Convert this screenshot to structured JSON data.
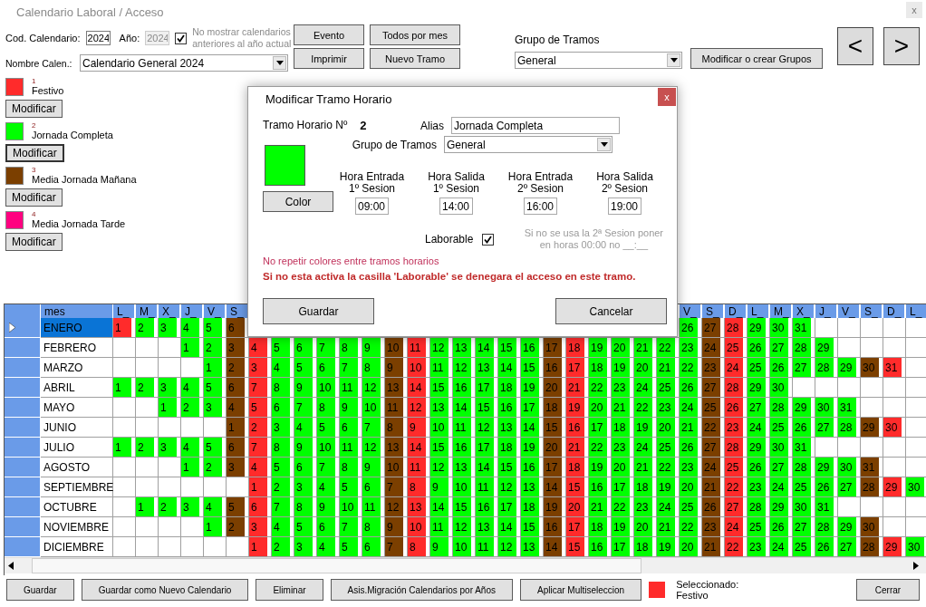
{
  "window": {
    "title": "Calendario Laboral / Acceso",
    "close": "x"
  },
  "form": {
    "cod_label": "Cod. Calendario:",
    "cod_value": "2024",
    "year_label": "Año:",
    "year_value": "2024",
    "year_disabled": true,
    "hide_old": {
      "label": "No mostrar calendarios anteriores al año actual",
      "checked": true
    },
    "name_label": "Nombre Calen.:",
    "name_value": "Calendario General 2024"
  },
  "toolbar": [
    "Evento",
    "Todos por mes",
    "Imprimir",
    "Nuevo Tramo"
  ],
  "group": {
    "label": "Grupo de Tramos",
    "value": "General",
    "button": "Modificar o crear Grupos"
  },
  "nav": [
    "<",
    ">"
  ],
  "tramos": [
    {
      "number": "1",
      "name": "Festivo",
      "color": "#ff2b2b",
      "button": "Modificar",
      "focused": false
    },
    {
      "number": "2",
      "name": "Jornada Completa",
      "color": "#00ff00",
      "button": "Modificar",
      "focused": true
    },
    {
      "number": "3",
      "name": "Media Jornada Mañana",
      "color": "#7b3f00",
      "button": "Modificar",
      "focused": false
    },
    {
      "number": "4",
      "name": "Media Jornada Tarde",
      "color": "#ff0080",
      "button": "Modificar",
      "focused": false
    }
  ],
  "grid": {
    "header": "mes",
    "columns": [
      "L_",
      "M_",
      "X_",
      "J_",
      "V_",
      "S_",
      null,
      null,
      null,
      null,
      null,
      null,
      null,
      null,
      null,
      null,
      null,
      null,
      null,
      null,
      null,
      null,
      null,
      null,
      null,
      "V_",
      "S_",
      "D_",
      "L_",
      "M_",
      "X_",
      "J_",
      "V_",
      "S_",
      "D_",
      "L_"
    ],
    "months": [
      {
        "name": "ENERO",
        "selected": true,
        "cells": [
          {
            "day": "1",
            "color": "#ff2b2b"
          },
          {
            "day": "2",
            "color": "#00ff00"
          },
          {
            "day": "3",
            "color": "#00ff00"
          },
          {
            "day": "4",
            "color": "#00ff00"
          },
          {
            "day": "5",
            "color": "#00ff00"
          },
          {
            "day": "6",
            "color": "#7b3f00"
          },
          null,
          null,
          null,
          null,
          null,
          null,
          null,
          null,
          null,
          null,
          null,
          null,
          null,
          null,
          null,
          null,
          null,
          null,
          null,
          {
            "day": "26",
            "color": "#00ff00"
          },
          {
            "day": "27",
            "color": "#7b3f00"
          },
          {
            "day": "28",
            "color": "#ff2b2b"
          },
          {
            "day": "29",
            "color": "#00ff00"
          },
          {
            "day": "30",
            "color": "#00ff00"
          },
          {
            "day": "31",
            "color": "#00ff00"
          },
          null,
          null,
          null,
          null,
          null
        ]
      },
      {
        "name": "FEBRERO",
        "selected": false,
        "cells": [
          null,
          null,
          null,
          {
            "day": "1",
            "color": "#00ff00"
          },
          {
            "day": "2",
            "color": "#00ff00"
          },
          {
            "day": "3",
            "color": "#7b3f00"
          },
          {
            "day": "4",
            "color": "#ff2b2b"
          },
          {
            "day": "5",
            "color": "#00ff00"
          },
          {
            "day": "6",
            "color": "#00ff00"
          },
          {
            "day": "7",
            "color": "#00ff00"
          },
          {
            "day": "8",
            "color": "#00ff00"
          },
          {
            "day": "9",
            "color": "#00ff00"
          },
          {
            "day": "10",
            "color": "#7b3f00"
          },
          {
            "day": "11",
            "color": "#ff2b2b"
          },
          {
            "day": "12",
            "color": "#00ff00"
          },
          {
            "day": "13",
            "color": "#00ff00"
          },
          {
            "day": "14",
            "color": "#00ff00"
          },
          {
            "day": "15",
            "color": "#00ff00"
          },
          {
            "day": "16",
            "color": "#00ff00"
          },
          {
            "day": "17",
            "color": "#7b3f00"
          },
          {
            "day": "18",
            "color": "#ff2b2b"
          },
          {
            "day": "19",
            "color": "#00ff00"
          },
          {
            "day": "20",
            "color": "#00ff00"
          },
          {
            "day": "21",
            "color": "#00ff00"
          },
          {
            "day": "22",
            "color": "#00ff00"
          },
          {
            "day": "23",
            "color": "#00ff00"
          },
          {
            "day": "24",
            "color": "#7b3f00"
          },
          {
            "day": "25",
            "color": "#ff2b2b"
          },
          {
            "day": "26",
            "color": "#00ff00"
          },
          {
            "day": "27",
            "color": "#00ff00"
          },
          {
            "day": "28",
            "color": "#00ff00"
          },
          {
            "day": "29",
            "color": "#00ff00"
          },
          null,
          null,
          null,
          null
        ]
      },
      {
        "name": "MARZO",
        "selected": false,
        "cells": [
          null,
          null,
          null,
          null,
          {
            "day": "1",
            "color": "#00ff00"
          },
          {
            "day": "2",
            "color": "#7b3f00"
          },
          {
            "day": "3",
            "color": "#ff2b2b"
          },
          {
            "day": "4",
            "color": "#00ff00"
          },
          {
            "day": "5",
            "color": "#00ff00"
          },
          {
            "day": "6",
            "color": "#00ff00"
          },
          {
            "day": "7",
            "color": "#00ff00"
          },
          {
            "day": "8",
            "color": "#00ff00"
          },
          {
            "day": "9",
            "color": "#7b3f00"
          },
          {
            "day": "10",
            "color": "#ff2b2b"
          },
          {
            "day": "11",
            "color": "#00ff00"
          },
          {
            "day": "12",
            "color": "#00ff00"
          },
          {
            "day": "13",
            "color": "#00ff00"
          },
          {
            "day": "14",
            "color": "#00ff00"
          },
          {
            "day": "15",
            "color": "#00ff00"
          },
          {
            "day": "16",
            "color": "#7b3f00"
          },
          {
            "day": "17",
            "color": "#ff2b2b"
          },
          {
            "day": "18",
            "color": "#00ff00"
          },
          {
            "day": "19",
            "color": "#00ff00"
          },
          {
            "day": "20",
            "color": "#00ff00"
          },
          {
            "day": "21",
            "color": "#00ff00"
          },
          {
            "day": "22",
            "color": "#00ff00"
          },
          {
            "day": "23",
            "color": "#7b3f00"
          },
          {
            "day": "24",
            "color": "#ff2b2b"
          },
          {
            "day": "25",
            "color": "#00ff00"
          },
          {
            "day": "26",
            "color": "#00ff00"
          },
          {
            "day": "27",
            "color": "#00ff00"
          },
          {
            "day": "28",
            "color": "#00ff00"
          },
          {
            "day": "29",
            "color": "#00ff00"
          },
          {
            "day": "30",
            "color": "#7b3f00"
          },
          {
            "day": "31",
            "color": "#ff2b2b"
          },
          null
        ]
      },
      {
        "name": "ABRIL",
        "selected": false,
        "cells": [
          {
            "day": "1",
            "color": "#00ff00"
          },
          {
            "day": "2",
            "color": "#00ff00"
          },
          {
            "day": "3",
            "color": "#00ff00"
          },
          {
            "day": "4",
            "color": "#00ff00"
          },
          {
            "day": "5",
            "color": "#00ff00"
          },
          {
            "day": "6",
            "color": "#7b3f00"
          },
          {
            "day": "7",
            "color": "#ff2b2b"
          },
          {
            "day": "8",
            "color": "#00ff00"
          },
          {
            "day": "9",
            "color": "#00ff00"
          },
          {
            "day": "10",
            "color": "#00ff00"
          },
          {
            "day": "11",
            "color": "#00ff00"
          },
          {
            "day": "12",
            "color": "#00ff00"
          },
          {
            "day": "13",
            "color": "#7b3f00"
          },
          {
            "day": "14",
            "color": "#ff2b2b"
          },
          {
            "day": "15",
            "color": "#00ff00"
          },
          {
            "day": "16",
            "color": "#00ff00"
          },
          {
            "day": "17",
            "color": "#00ff00"
          },
          {
            "day": "18",
            "color": "#00ff00"
          },
          {
            "day": "19",
            "color": "#00ff00"
          },
          {
            "day": "20",
            "color": "#7b3f00"
          },
          {
            "day": "21",
            "color": "#ff2b2b"
          },
          {
            "day": "22",
            "color": "#00ff00"
          },
          {
            "day": "23",
            "color": "#00ff00"
          },
          {
            "day": "24",
            "color": "#00ff00"
          },
          {
            "day": "25",
            "color": "#00ff00"
          },
          {
            "day": "26",
            "color": "#00ff00"
          },
          {
            "day": "27",
            "color": "#7b3f00"
          },
          {
            "day": "28",
            "color": "#ff2b2b"
          },
          {
            "day": "29",
            "color": "#00ff00"
          },
          {
            "day": "30",
            "color": "#00ff00"
          },
          null,
          null,
          null,
          null,
          null,
          null
        ]
      },
      {
        "name": "MAYO",
        "selected": false,
        "cells": [
          null,
          null,
          {
            "day": "1",
            "color": "#00ff00"
          },
          {
            "day": "2",
            "color": "#00ff00"
          },
          {
            "day": "3",
            "color": "#00ff00"
          },
          {
            "day": "4",
            "color": "#7b3f00"
          },
          {
            "day": "5",
            "color": "#ff2b2b"
          },
          {
            "day": "6",
            "color": "#00ff00"
          },
          {
            "day": "7",
            "color": "#00ff00"
          },
          {
            "day": "8",
            "color": "#00ff00"
          },
          {
            "day": "9",
            "color": "#00ff00"
          },
          {
            "day": "10",
            "color": "#00ff00"
          },
          {
            "day": "11",
            "color": "#7b3f00"
          },
          {
            "day": "12",
            "color": "#ff2b2b"
          },
          {
            "day": "13",
            "color": "#00ff00"
          },
          {
            "day": "14",
            "color": "#00ff00"
          },
          {
            "day": "15",
            "color": "#00ff00"
          },
          {
            "day": "16",
            "color": "#00ff00"
          },
          {
            "day": "17",
            "color": "#00ff00"
          },
          {
            "day": "18",
            "color": "#7b3f00"
          },
          {
            "day": "19",
            "color": "#ff2b2b"
          },
          {
            "day": "20",
            "color": "#00ff00"
          },
          {
            "day": "21",
            "color": "#00ff00"
          },
          {
            "day": "22",
            "color": "#00ff00"
          },
          {
            "day": "23",
            "color": "#00ff00"
          },
          {
            "day": "24",
            "color": "#00ff00"
          },
          {
            "day": "25",
            "color": "#7b3f00"
          },
          {
            "day": "26",
            "color": "#ff2b2b"
          },
          {
            "day": "27",
            "color": "#00ff00"
          },
          {
            "day": "28",
            "color": "#00ff00"
          },
          {
            "day": "29",
            "color": "#00ff00"
          },
          {
            "day": "30",
            "color": "#00ff00"
          },
          {
            "day": "31",
            "color": "#00ff00"
          },
          null,
          null,
          null
        ]
      },
      {
        "name": "JUNIO",
        "selected": false,
        "cells": [
          null,
          null,
          null,
          null,
          null,
          {
            "day": "1",
            "color": "#7b3f00"
          },
          {
            "day": "2",
            "color": "#ff2b2b"
          },
          {
            "day": "3",
            "color": "#00ff00"
          },
          {
            "day": "4",
            "color": "#00ff00"
          },
          {
            "day": "5",
            "color": "#00ff00"
          },
          {
            "day": "6",
            "color": "#00ff00"
          },
          {
            "day": "7",
            "color": "#00ff00"
          },
          {
            "day": "8",
            "color": "#7b3f00"
          },
          {
            "day": "9",
            "color": "#ff2b2b"
          },
          {
            "day": "10",
            "color": "#00ff00"
          },
          {
            "day": "11",
            "color": "#00ff00"
          },
          {
            "day": "12",
            "color": "#00ff00"
          },
          {
            "day": "13",
            "color": "#00ff00"
          },
          {
            "day": "14",
            "color": "#00ff00"
          },
          {
            "day": "15",
            "color": "#7b3f00"
          },
          {
            "day": "16",
            "color": "#ff2b2b"
          },
          {
            "day": "17",
            "color": "#00ff00"
          },
          {
            "day": "18",
            "color": "#00ff00"
          },
          {
            "day": "19",
            "color": "#00ff00"
          },
          {
            "day": "20",
            "color": "#00ff00"
          },
          {
            "day": "21",
            "color": "#00ff00"
          },
          {
            "day": "22",
            "color": "#7b3f00"
          },
          {
            "day": "23",
            "color": "#ff2b2b"
          },
          {
            "day": "24",
            "color": "#00ff00"
          },
          {
            "day": "25",
            "color": "#00ff00"
          },
          {
            "day": "26",
            "color": "#00ff00"
          },
          {
            "day": "27",
            "color": "#00ff00"
          },
          {
            "day": "28",
            "color": "#00ff00"
          },
          {
            "day": "29",
            "color": "#7b3f00"
          },
          {
            "day": "30",
            "color": "#ff2b2b"
          },
          null
        ]
      },
      {
        "name": "JULIO",
        "selected": false,
        "cells": [
          {
            "day": "1",
            "color": "#00ff00"
          },
          {
            "day": "2",
            "color": "#00ff00"
          },
          {
            "day": "3",
            "color": "#00ff00"
          },
          {
            "day": "4",
            "color": "#00ff00"
          },
          {
            "day": "5",
            "color": "#00ff00"
          },
          {
            "day": "6",
            "color": "#7b3f00"
          },
          {
            "day": "7",
            "color": "#ff2b2b"
          },
          {
            "day": "8",
            "color": "#00ff00"
          },
          {
            "day": "9",
            "color": "#00ff00"
          },
          {
            "day": "10",
            "color": "#00ff00"
          },
          {
            "day": "11",
            "color": "#00ff00"
          },
          {
            "day": "12",
            "color": "#00ff00"
          },
          {
            "day": "13",
            "color": "#7b3f00"
          },
          {
            "day": "14",
            "color": "#ff2b2b"
          },
          {
            "day": "15",
            "color": "#00ff00"
          },
          {
            "day": "16",
            "color": "#00ff00"
          },
          {
            "day": "17",
            "color": "#00ff00"
          },
          {
            "day": "18",
            "color": "#00ff00"
          },
          {
            "day": "19",
            "color": "#00ff00"
          },
          {
            "day": "20",
            "color": "#7b3f00"
          },
          {
            "day": "21",
            "color": "#ff2b2b"
          },
          {
            "day": "22",
            "color": "#00ff00"
          },
          {
            "day": "23",
            "color": "#00ff00"
          },
          {
            "day": "24",
            "color": "#00ff00"
          },
          {
            "day": "25",
            "color": "#00ff00"
          },
          {
            "day": "26",
            "color": "#00ff00"
          },
          {
            "day": "27",
            "color": "#7b3f00"
          },
          {
            "day": "28",
            "color": "#ff2b2b"
          },
          {
            "day": "29",
            "color": "#00ff00"
          },
          {
            "day": "30",
            "color": "#00ff00"
          },
          {
            "day": "31",
            "color": "#00ff00"
          },
          null,
          null,
          null,
          null,
          null
        ]
      },
      {
        "name": "AGOSTO",
        "selected": false,
        "cells": [
          null,
          null,
          null,
          {
            "day": "1",
            "color": "#00ff00"
          },
          {
            "day": "2",
            "color": "#00ff00"
          },
          {
            "day": "3",
            "color": "#7b3f00"
          },
          {
            "day": "4",
            "color": "#ff2b2b"
          },
          {
            "day": "5",
            "color": "#00ff00"
          },
          {
            "day": "6",
            "color": "#00ff00"
          },
          {
            "day": "7",
            "color": "#00ff00"
          },
          {
            "day": "8",
            "color": "#00ff00"
          },
          {
            "day": "9",
            "color": "#00ff00"
          },
          {
            "day": "10",
            "color": "#7b3f00"
          },
          {
            "day": "11",
            "color": "#ff2b2b"
          },
          {
            "day": "12",
            "color": "#00ff00"
          },
          {
            "day": "13",
            "color": "#00ff00"
          },
          {
            "day": "14",
            "color": "#00ff00"
          },
          {
            "day": "15",
            "color": "#00ff00"
          },
          {
            "day": "16",
            "color": "#00ff00"
          },
          {
            "day": "17",
            "color": "#7b3f00"
          },
          {
            "day": "18",
            "color": "#ff2b2b"
          },
          {
            "day": "19",
            "color": "#00ff00"
          },
          {
            "day": "20",
            "color": "#00ff00"
          },
          {
            "day": "21",
            "color": "#00ff00"
          },
          {
            "day": "22",
            "color": "#00ff00"
          },
          {
            "day": "23",
            "color": "#00ff00"
          },
          {
            "day": "24",
            "color": "#7b3f00"
          },
          {
            "day": "25",
            "color": "#ff2b2b"
          },
          {
            "day": "26",
            "color": "#00ff00"
          },
          {
            "day": "27",
            "color": "#00ff00"
          },
          {
            "day": "28",
            "color": "#00ff00"
          },
          {
            "day": "29",
            "color": "#00ff00"
          },
          {
            "day": "30",
            "color": "#00ff00"
          },
          {
            "day": "31",
            "color": "#7b3f00"
          },
          null,
          null
        ]
      },
      {
        "name": "SEPTIEMBRE",
        "selected": false,
        "cells": [
          null,
          null,
          null,
          null,
          null,
          null,
          {
            "day": "1",
            "color": "#ff2b2b"
          },
          {
            "day": "2",
            "color": "#00ff00"
          },
          {
            "day": "3",
            "color": "#00ff00"
          },
          {
            "day": "4",
            "color": "#00ff00"
          },
          {
            "day": "5",
            "color": "#00ff00"
          },
          {
            "day": "6",
            "color": "#00ff00"
          },
          {
            "day": "7",
            "color": "#7b3f00"
          },
          {
            "day": "8",
            "color": "#ff2b2b"
          },
          {
            "day": "9",
            "color": "#00ff00"
          },
          {
            "day": "10",
            "color": "#00ff00"
          },
          {
            "day": "11",
            "color": "#00ff00"
          },
          {
            "day": "12",
            "color": "#00ff00"
          },
          {
            "day": "13",
            "color": "#00ff00"
          },
          {
            "day": "14",
            "color": "#7b3f00"
          },
          {
            "day": "15",
            "color": "#ff2b2b"
          },
          {
            "day": "16",
            "color": "#00ff00"
          },
          {
            "day": "17",
            "color": "#00ff00"
          },
          {
            "day": "18",
            "color": "#00ff00"
          },
          {
            "day": "19",
            "color": "#00ff00"
          },
          {
            "day": "20",
            "color": "#00ff00"
          },
          {
            "day": "21",
            "color": "#7b3f00"
          },
          {
            "day": "22",
            "color": "#ff2b2b"
          },
          {
            "day": "23",
            "color": "#00ff00"
          },
          {
            "day": "24",
            "color": "#00ff00"
          },
          {
            "day": "25",
            "color": "#00ff00"
          },
          {
            "day": "26",
            "color": "#00ff00"
          },
          {
            "day": "27",
            "color": "#00ff00"
          },
          {
            "day": "28",
            "color": "#7b3f00"
          },
          {
            "day": "29",
            "color": "#ff2b2b"
          },
          {
            "day": "30",
            "color": "#00ff00"
          }
        ]
      },
      {
        "name": "OCTUBRE",
        "selected": false,
        "cells": [
          null,
          {
            "day": "1",
            "color": "#00ff00"
          },
          {
            "day": "2",
            "color": "#00ff00"
          },
          {
            "day": "3",
            "color": "#00ff00"
          },
          {
            "day": "4",
            "color": "#00ff00"
          },
          {
            "day": "5",
            "color": "#7b3f00"
          },
          {
            "day": "6",
            "color": "#ff2b2b"
          },
          {
            "day": "7",
            "color": "#00ff00"
          },
          {
            "day": "8",
            "color": "#00ff00"
          },
          {
            "day": "9",
            "color": "#00ff00"
          },
          {
            "day": "10",
            "color": "#00ff00"
          },
          {
            "day": "11",
            "color": "#00ff00"
          },
          {
            "day": "12",
            "color": "#7b3f00"
          },
          {
            "day": "13",
            "color": "#ff2b2b"
          },
          {
            "day": "14",
            "color": "#00ff00"
          },
          {
            "day": "15",
            "color": "#00ff00"
          },
          {
            "day": "16",
            "color": "#00ff00"
          },
          {
            "day": "17",
            "color": "#00ff00"
          },
          {
            "day": "18",
            "color": "#00ff00"
          },
          {
            "day": "19",
            "color": "#7b3f00"
          },
          {
            "day": "20",
            "color": "#ff2b2b"
          },
          {
            "day": "21",
            "color": "#00ff00"
          },
          {
            "day": "22",
            "color": "#00ff00"
          },
          {
            "day": "23",
            "color": "#00ff00"
          },
          {
            "day": "24",
            "color": "#00ff00"
          },
          {
            "day": "25",
            "color": "#00ff00"
          },
          {
            "day": "26",
            "color": "#7b3f00"
          },
          {
            "day": "27",
            "color": "#ff2b2b"
          },
          {
            "day": "28",
            "color": "#00ff00"
          },
          {
            "day": "29",
            "color": "#00ff00"
          },
          {
            "day": "30",
            "color": "#00ff00"
          },
          {
            "day": "31",
            "color": "#00ff00"
          },
          null,
          null,
          null,
          null
        ]
      },
      {
        "name": "NOVIEMBRE",
        "selected": false,
        "cells": [
          null,
          null,
          null,
          null,
          {
            "day": "1",
            "color": "#00ff00"
          },
          {
            "day": "2",
            "color": "#7b3f00"
          },
          {
            "day": "3",
            "color": "#ff2b2b"
          },
          {
            "day": "4",
            "color": "#00ff00"
          },
          {
            "day": "5",
            "color": "#00ff00"
          },
          {
            "day": "6",
            "color": "#00ff00"
          },
          {
            "day": "7",
            "color": "#00ff00"
          },
          {
            "day": "8",
            "color": "#00ff00"
          },
          {
            "day": "9",
            "color": "#7b3f00"
          },
          {
            "day": "10",
            "color": "#ff2b2b"
          },
          {
            "day": "11",
            "color": "#00ff00"
          },
          {
            "day": "12",
            "color": "#00ff00"
          },
          {
            "day": "13",
            "color": "#00ff00"
          },
          {
            "day": "14",
            "color": "#00ff00"
          },
          {
            "day": "15",
            "color": "#00ff00"
          },
          {
            "day": "16",
            "color": "#7b3f00"
          },
          {
            "day": "17",
            "color": "#ff2b2b"
          },
          {
            "day": "18",
            "color": "#00ff00"
          },
          {
            "day": "19",
            "color": "#00ff00"
          },
          {
            "day": "20",
            "color": "#00ff00"
          },
          {
            "day": "21",
            "color": "#00ff00"
          },
          {
            "day": "22",
            "color": "#00ff00"
          },
          {
            "day": "23",
            "color": "#7b3f00"
          },
          {
            "day": "24",
            "color": "#ff2b2b"
          },
          {
            "day": "25",
            "color": "#00ff00"
          },
          {
            "day": "26",
            "color": "#00ff00"
          },
          {
            "day": "27",
            "color": "#00ff00"
          },
          {
            "day": "28",
            "color": "#00ff00"
          },
          {
            "day": "29",
            "color": "#00ff00"
          },
          {
            "day": "30",
            "color": "#7b3f00"
          },
          null,
          null
        ]
      },
      {
        "name": "DICIEMBRE",
        "selected": false,
        "cells": [
          null,
          null,
          null,
          null,
          null,
          null,
          {
            "day": "1",
            "color": "#ff2b2b"
          },
          {
            "day": "2",
            "color": "#00ff00"
          },
          {
            "day": "3",
            "color": "#00ff00"
          },
          {
            "day": "4",
            "color": "#00ff00"
          },
          {
            "day": "5",
            "color": "#00ff00"
          },
          {
            "day": "6",
            "color": "#00ff00"
          },
          {
            "day": "7",
            "color": "#7b3f00"
          },
          {
            "day": "8",
            "color": "#ff2b2b"
          },
          {
            "day": "9",
            "color": "#00ff00"
          },
          {
            "day": "10",
            "color": "#00ff00"
          },
          {
            "day": "11",
            "color": "#00ff00"
          },
          {
            "day": "12",
            "color": "#00ff00"
          },
          {
            "day": "13",
            "color": "#00ff00"
          },
          {
            "day": "14",
            "color": "#7b3f00"
          },
          {
            "day": "15",
            "color": "#ff2b2b"
          },
          {
            "day": "16",
            "color": "#00ff00"
          },
          {
            "day": "17",
            "color": "#00ff00"
          },
          {
            "day": "18",
            "color": "#00ff00"
          },
          {
            "day": "19",
            "color": "#00ff00"
          },
          {
            "day": "20",
            "color": "#00ff00"
          },
          {
            "day": "21",
            "color": "#7b3f00"
          },
          {
            "day": "22",
            "color": "#ff2b2b"
          },
          {
            "day": "23",
            "color": "#00ff00"
          },
          {
            "day": "24",
            "color": "#00ff00"
          },
          {
            "day": "25",
            "color": "#00ff00"
          },
          {
            "day": "26",
            "color": "#00ff00"
          },
          {
            "day": "27",
            "color": "#00ff00"
          },
          {
            "day": "28",
            "color": "#7b3f00"
          },
          {
            "day": "29",
            "color": "#ff2b2b"
          },
          {
            "day": "30",
            "color": "#00ff00"
          }
        ]
      }
    ]
  },
  "dialog": {
    "title": "Modificar Tramo Horario",
    "close": "x",
    "number_label": "Tramo Horario Nº",
    "number": "2",
    "alias_label": "Alias",
    "alias": "Jornada Completa",
    "group_label": "Grupo de Tramos",
    "group": "General",
    "color": "#00ff00",
    "color_button": "Color",
    "sessions": [
      {
        "title": "Hora Entrada",
        "session": "1º Sesion",
        "value": "09:00"
      },
      {
        "title": "Hora Salida",
        "session": "1º Sesion",
        "value": "14:00"
      },
      {
        "title": "Hora Entrada",
        "session": "2º Sesion",
        "value": "16:00"
      },
      {
        "title": "Hora Salida",
        "session": "2º Sesion",
        "value": "19:00"
      }
    ],
    "laborable": {
      "label": "Laborable",
      "checked": true
    },
    "note": "Si no se usa la 2ª Sesion poner en horas 00:00 no __:__",
    "warning": "No repetir colores entre tramos horarios",
    "alert": "Si no esta activa la casilla 'Laborable' se denegara el acceso en este tramo.",
    "buttons": [
      "Guardar",
      "Cancelar"
    ]
  },
  "footer": {
    "buttons": [
      "Guardar",
      "Guardar como Nuevo Calendario",
      "Eliminar",
      "Asis.Migración Calendarios por Años",
      "Aplicar Multiseleccion"
    ],
    "selected": {
      "label": "Seleccionado:",
      "value": "Festivo",
      "color": "#ff2b2b"
    },
    "close": "Cerrar"
  }
}
